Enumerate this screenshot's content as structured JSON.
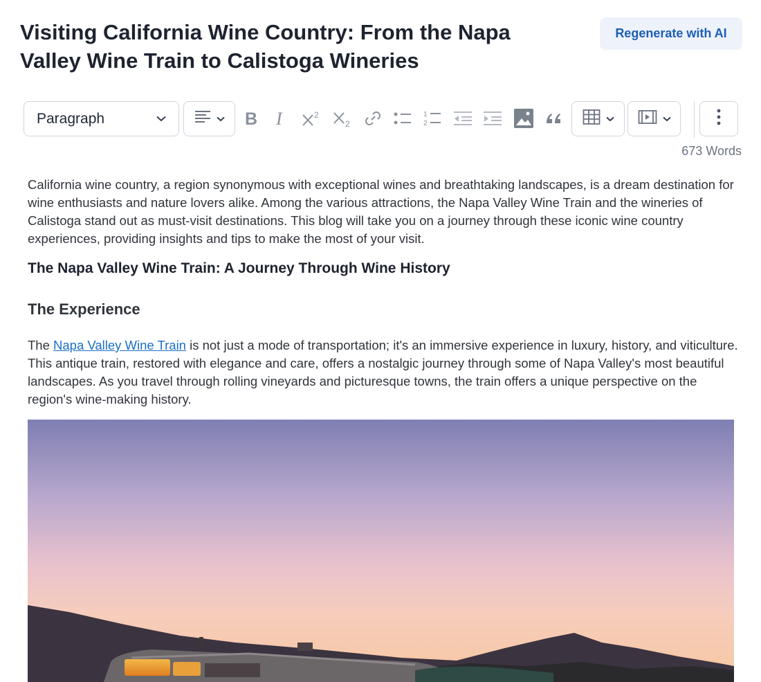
{
  "header": {
    "title": "Visiting California Wine Country: From the Napa Valley Wine Train to Calistoga Wineries",
    "regenerate_label": "Regenerate with AI"
  },
  "toolbar": {
    "block_type": "Paragraph",
    "word_count": "673 Words",
    "icons": [
      "align-icon",
      "bold-icon",
      "italic-icon",
      "superscript-icon",
      "subscript-icon",
      "link-icon",
      "bulleted-list-icon",
      "numbered-list-icon",
      "outdent-icon",
      "indent-icon",
      "image-icon",
      "blockquote-icon",
      "table-icon",
      "media-icon",
      "more-icon"
    ]
  },
  "article": {
    "intro": "California wine country, a region synonymous with exceptional wines and breathtaking landscapes, is a dream destination for wine enthusiasts and nature lovers alike. Among the various attractions, the Napa Valley Wine Train and the wineries of Calistoga stand out as must-visit destinations. This blog will take you on a journey through these iconic wine country experiences, providing insights and tips to make the most of your visit.",
    "heading": "The Napa Valley Wine Train: A Journey Through Wine History",
    "subheading": "The Experience",
    "para_prefix": "The ",
    "para_link": "Napa Valley Wine Train",
    "para_rest": " is not just a mode of transportation; it's an immersive experience in luxury, history, and viticulture. This antique train, restored with elegance and care, offers a nostalgic journey through some of Napa Valley's most beautiful landscapes. As you travel through rolling vineyards and picturesque towns, the train offers a unique perspective on the region's wine-making history."
  },
  "colors": {
    "accent": "#1b5fb3",
    "link": "#1b6fc6",
    "button_bg": "#eef2fb",
    "border": "#cfd4dc"
  }
}
